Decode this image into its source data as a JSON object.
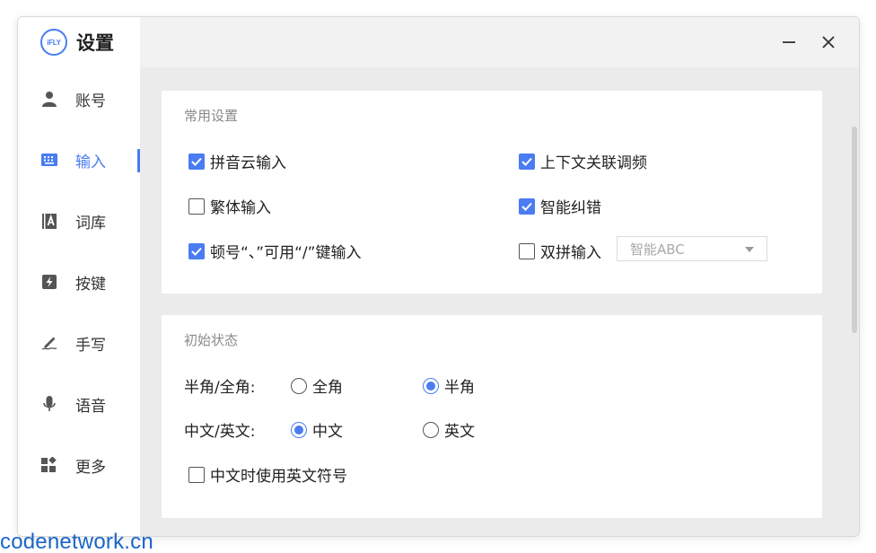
{
  "app": {
    "logo_text": "iFLY",
    "title": "设置"
  },
  "sidebar": {
    "items": [
      {
        "label": "账号",
        "icon": "user-icon"
      },
      {
        "label": "输入",
        "icon": "keyboard-icon",
        "active": true
      },
      {
        "label": "词库",
        "icon": "dictionary-icon"
      },
      {
        "label": "按键",
        "icon": "key-icon"
      },
      {
        "label": "手写",
        "icon": "pen-icon"
      },
      {
        "label": "语音",
        "icon": "microphone-icon"
      },
      {
        "label": "更多",
        "icon": "more-apps-icon"
      }
    ]
  },
  "common": {
    "title": "常用设置",
    "pinyin_cloud": {
      "label": "拼音云输入",
      "checked": true
    },
    "context_freq": {
      "label": "上下文关联调频",
      "checked": true
    },
    "traditional": {
      "label": "繁体输入",
      "checked": false
    },
    "smart_correct": {
      "label": "智能纠错",
      "checked": true
    },
    "dunhao": {
      "label": "顿号“、”可用“/”键输入",
      "checked": true
    },
    "shuangpin": {
      "label": "双拼输入",
      "checked": false
    },
    "shuangpin_scheme": "智能ABC"
  },
  "initial": {
    "title": "初始状态",
    "width_label": "半角/全角:",
    "full_width": {
      "label": "全角",
      "checked": false
    },
    "half_width": {
      "label": "半角",
      "checked": true
    },
    "lang_label": "中文/英文:",
    "chinese": {
      "label": "中文",
      "checked": true
    },
    "english": {
      "label": "英文",
      "checked": false
    },
    "english_punct": {
      "label": "中文时使用英文符号",
      "checked": false
    }
  },
  "colors": {
    "accent": "#4a7cf2"
  },
  "watermark": "codenetwork.cn"
}
